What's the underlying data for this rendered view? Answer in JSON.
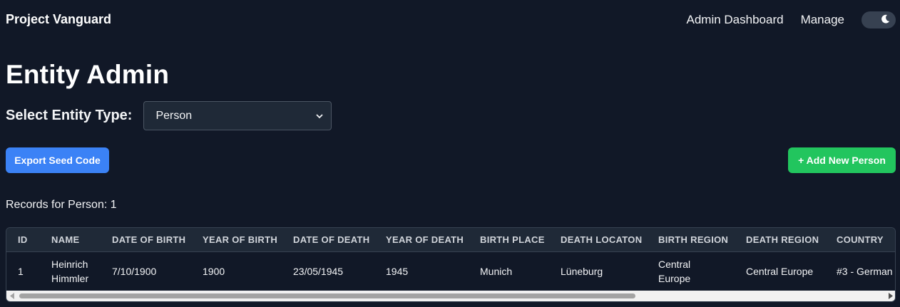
{
  "header": {
    "brand": "Project Vanguard",
    "links": [
      "Admin Dashboard",
      "Manage"
    ],
    "theme_toggle_icon": "moon-icon"
  },
  "page": {
    "title": "Entity Admin",
    "select_label": "Select Entity Type:",
    "select_value": "Person",
    "export_button": "Export Seed Code",
    "add_button": "+ Add New Person",
    "records_text": "Records for Person: 1"
  },
  "table": {
    "columns": [
      "ID",
      "NAME",
      "DATE OF BIRTH",
      "YEAR OF BIRTH",
      "DATE OF DEATH",
      "YEAR OF DEATH",
      "BIRTH PLACE",
      "DEATH LOCATON",
      "BIRTH REGION",
      "DEATH REGION",
      "COUNTRY"
    ],
    "rows": [
      {
        "id": "1",
        "name_line1": "Heinrich",
        "name_line2": "Himmler",
        "date_of_birth": "7/10/1900",
        "year_of_birth": "1900",
        "date_of_death": "23/05/1945",
        "year_of_death": "1945",
        "birth_place": "Munich",
        "death_location": "Lüneburg",
        "birth_region_line1": "Central",
        "birth_region_line2": "Europe",
        "death_region": "Central Europe",
        "country": "#3 - German"
      }
    ]
  },
  "colors": {
    "background": "#111827",
    "export_button": "#3b82f6",
    "add_button": "#22c55e",
    "table_header": "#1f2937"
  }
}
